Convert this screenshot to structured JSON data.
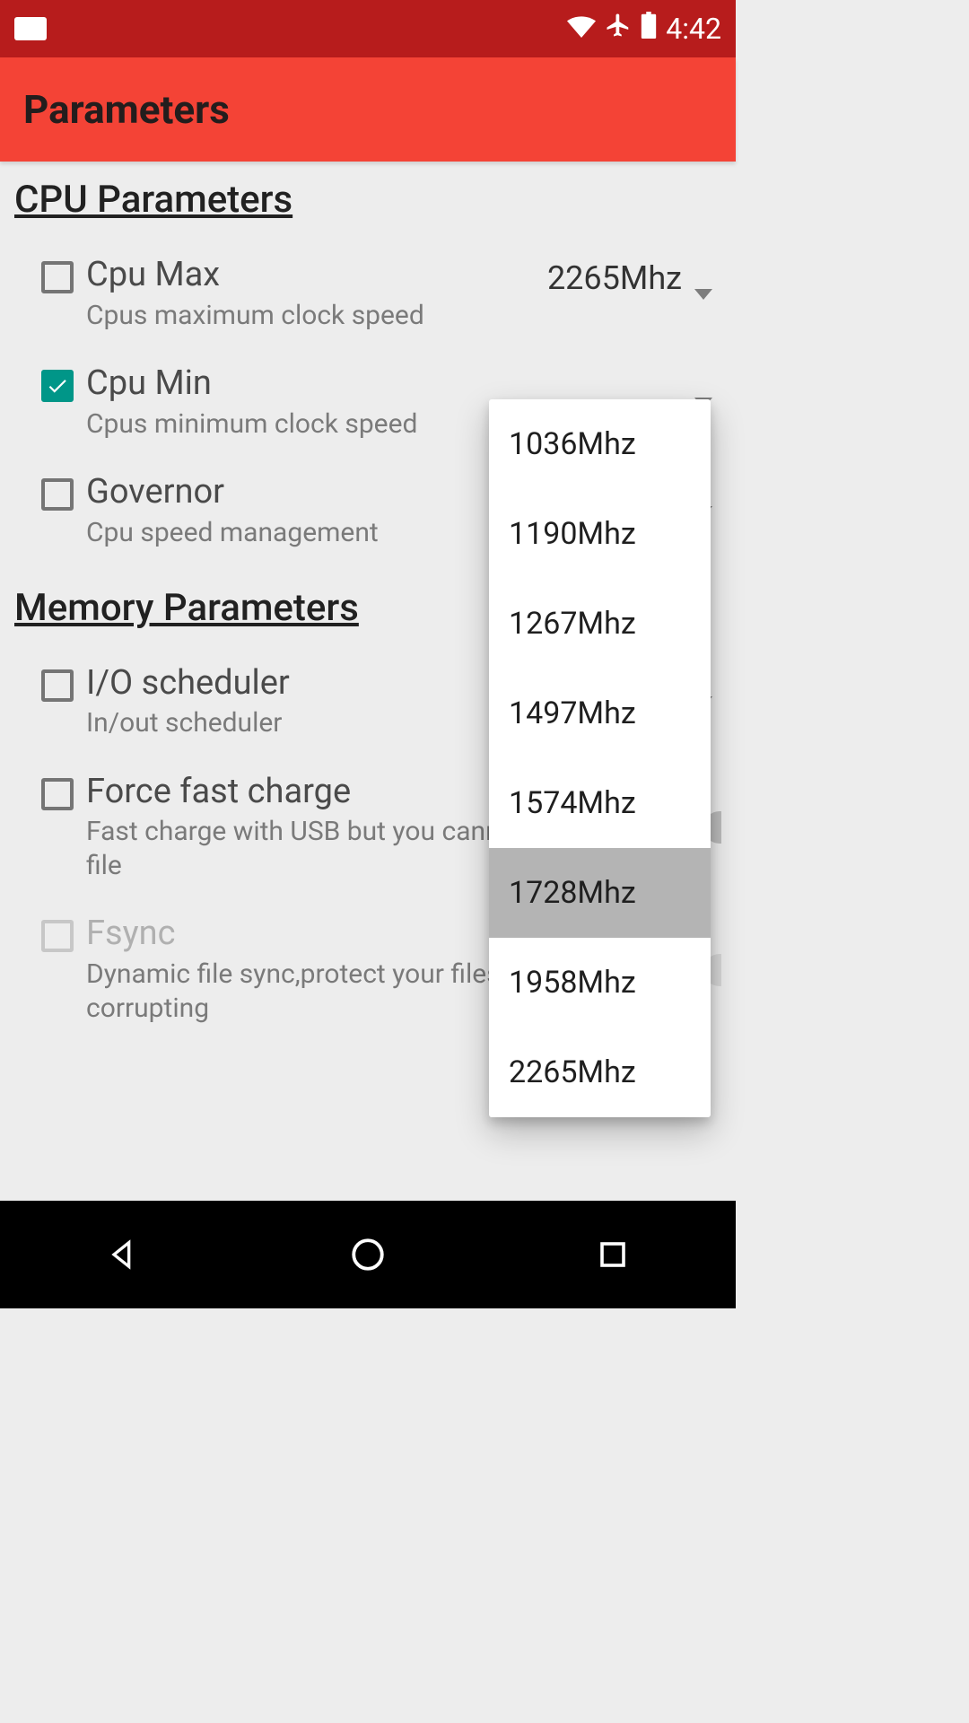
{
  "statusbar": {
    "time": "4:42"
  },
  "appbar": {
    "title": "Parameters"
  },
  "sections": {
    "cpu": {
      "heading": "CPU Parameters",
      "rows": {
        "max": {
          "title": "Cpu Max",
          "sub": "Cpus maximum clock speed",
          "value": "2265Mhz"
        },
        "min": {
          "title": "Cpu Min",
          "sub": "Cpus minimum clock speed"
        },
        "gov": {
          "title": "Governor",
          "sub": "Cpu speed management"
        }
      }
    },
    "mem": {
      "heading": "Memory Parameters",
      "rows": {
        "io": {
          "title": "I/O scheduler",
          "sub": "In/out scheduler"
        },
        "ffc": {
          "title": "Force fast charge",
          "sub": "Fast charge with USB but you cannot able to use file"
        },
        "fsync": {
          "title": "Fsync",
          "sub": "Dynamic file sync,protect your files from corrupting"
        }
      }
    }
  },
  "dropdown": {
    "items": [
      "1036Mhz",
      "1190Mhz",
      "1267Mhz",
      "1497Mhz",
      "1574Mhz",
      "1728Mhz",
      "1958Mhz",
      "2265Mhz"
    ],
    "selected_index": 5
  }
}
